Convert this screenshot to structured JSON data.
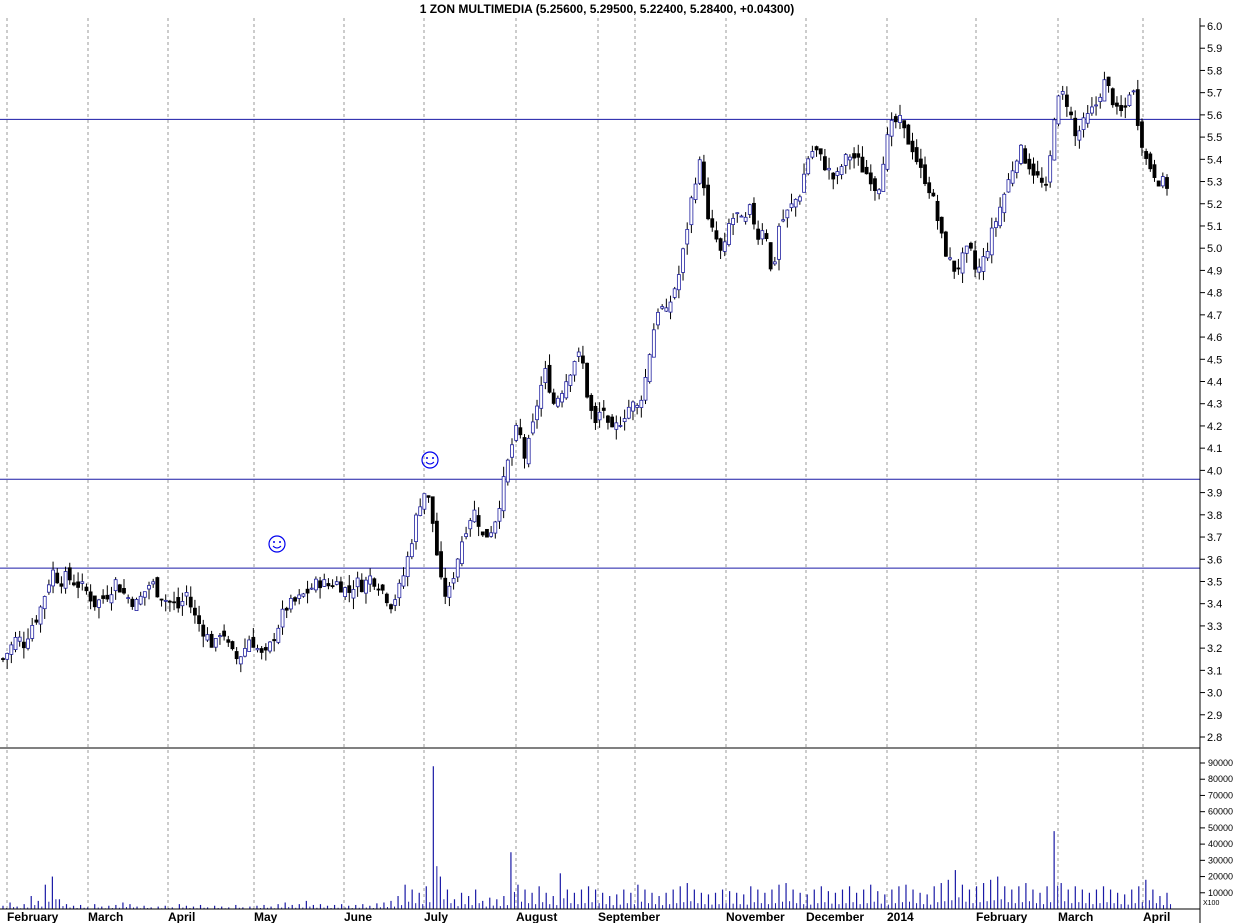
{
  "chart_data": {
    "type": "candlestick",
    "title": "1 ZON MULTIMEDIA (5.25600, 5.29500, 5.22400, 5.28400, +0.04300)",
    "price_ylim": [
      2.7,
      6.1
    ],
    "price_ticks": [
      "2.8",
      "2.9",
      "3.0",
      "3.1",
      "3.2",
      "3.3",
      "3.4",
      "3.5",
      "3.6",
      "3.7",
      "3.8",
      "3.9",
      "4.0",
      "4.1",
      "4.2",
      "4.3",
      "4.4",
      "4.5",
      "4.6",
      "4.7",
      "4.8",
      "4.9",
      "5.0",
      "5.1",
      "5.2",
      "5.3",
      "5.4",
      "5.5",
      "5.6",
      "5.7",
      "5.8",
      "5.9",
      "6.0"
    ],
    "volume_ylim": [
      0,
      95000
    ],
    "volume_ticks": [
      "10000",
      "20000",
      "30000",
      "40000",
      "50000",
      "60000",
      "70000",
      "80000",
      "90000"
    ],
    "volume_unit_label": "X100",
    "month_labels": [
      "February",
      "March",
      "April",
      "May",
      "June",
      "July",
      "August",
      "September",
      "November",
      "December",
      "2014",
      "February",
      "March",
      "April"
    ],
    "horizontal_lines": [
      3.56,
      3.96,
      5.58
    ],
    "grid": "vertical dashed at month starts",
    "close_series": [
      3.15,
      3.2,
      3.25,
      3.22,
      3.3,
      3.35,
      3.45,
      3.55,
      3.5,
      3.52,
      3.5,
      3.48,
      3.45,
      3.4,
      3.42,
      3.45,
      3.5,
      3.45,
      3.42,
      3.4,
      3.45,
      3.5,
      3.45,
      3.42,
      3.4,
      3.38,
      3.45,
      3.35,
      3.3,
      3.25,
      3.2,
      3.3,
      3.2,
      3.15,
      3.18,
      3.25,
      3.2,
      3.15,
      3.22,
      3.3,
      3.38,
      3.4,
      3.42,
      3.45,
      3.48,
      3.5,
      3.48,
      3.5,
      3.48,
      3.45,
      3.5,
      3.48,
      3.52,
      3.5,
      3.45,
      3.4,
      3.45,
      3.55,
      3.7,
      3.85,
      3.92,
      3.75,
      3.5,
      3.42,
      3.55,
      3.68,
      3.78,
      3.82,
      3.7,
      3.72,
      3.8,
      3.95,
      4.1,
      4.2,
      4.05,
      4.18,
      4.35,
      4.45,
      4.3,
      4.35,
      4.42,
      4.5,
      4.52,
      4.3,
      4.2,
      4.3,
      4.15,
      4.2,
      4.25,
      4.3,
      4.28,
      4.4,
      4.6,
      4.75,
      4.7,
      4.8,
      4.9,
      5.1,
      5.3,
      5.4,
      5.1,
      5.05,
      4.95,
      5.12,
      5.15,
      5.1,
      5.18,
      5.05,
      5.12,
      4.85,
      5.1,
      5.15,
      5.2,
      5.25,
      5.4,
      5.45,
      5.4,
      5.35,
      5.3,
      5.38,
      5.42,
      5.4,
      5.35,
      5.32,
      5.25,
      5.45,
      5.55,
      5.58,
      5.5,
      5.45,
      5.35,
      5.3,
      5.2,
      5.05,
      4.95,
      4.9,
      4.95,
      5.0,
      4.88,
      4.95,
      5.05,
      5.15,
      5.25,
      5.35,
      5.45,
      5.4,
      5.35,
      5.3,
      5.25,
      5.6,
      5.7,
      5.65,
      5.5,
      5.55,
      5.6,
      5.65,
      5.75,
      5.7,
      5.6,
      5.62,
      5.75,
      5.55,
      5.4,
      5.35,
      5.3,
      5.284
    ],
    "volume_series": [
      2000,
      4000,
      1500,
      3000,
      8000,
      5000,
      15000,
      20000,
      6000,
      3000,
      2000,
      2500,
      1000,
      3000,
      1500,
      2000,
      2500,
      4000,
      3000,
      1500,
      2000,
      1000,
      1500,
      2000,
      1000,
      3000,
      2000,
      1500,
      2500,
      1000,
      2000,
      1500,
      1000,
      2500,
      1000,
      1500,
      2000,
      2500,
      1500,
      3000,
      4000,
      2500,
      3000,
      5000,
      2500,
      3000,
      2000,
      2500,
      3000,
      2000,
      2500,
      3000,
      2000,
      3500,
      4000,
      5000,
      8000,
      15000,
      12000,
      10000,
      14000,
      88000,
      20000,
      12000,
      6000,
      10000,
      8000,
      12000,
      5000,
      7000,
      6000,
      8000,
      35000,
      15000,
      12000,
      10000,
      14000,
      10000,
      8000,
      22000,
      12000,
      10000,
      12000,
      14000,
      12000,
      10000,
      8000,
      9000,
      12000,
      10000,
      15000,
      12000,
      10000,
      8000,
      10000,
      12000,
      14000,
      16000,
      12000,
      10000,
      9000,
      10000,
      12000,
      11000,
      10000,
      9000,
      14000,
      12000,
      10000,
      12000,
      15000,
      16000,
      12000,
      10000,
      9000,
      12000,
      14000,
      11000,
      10000,
      12000,
      14000,
      10000,
      12000,
      15000,
      11000,
      9000,
      12000,
      14000,
      15000,
      12000,
      10000,
      9000,
      14000,
      16000,
      18000,
      24000,
      15000,
      12000,
      14000,
      16000,
      18000,
      20000,
      14000,
      12000,
      14000,
      16000,
      12000,
      10000,
      14000,
      48000,
      16000,
      12000,
      14000,
      12000,
      10000,
      12000,
      14000,
      12000,
      10000,
      9000,
      12000,
      14000,
      18000,
      12000,
      8000,
      10000
    ]
  }
}
